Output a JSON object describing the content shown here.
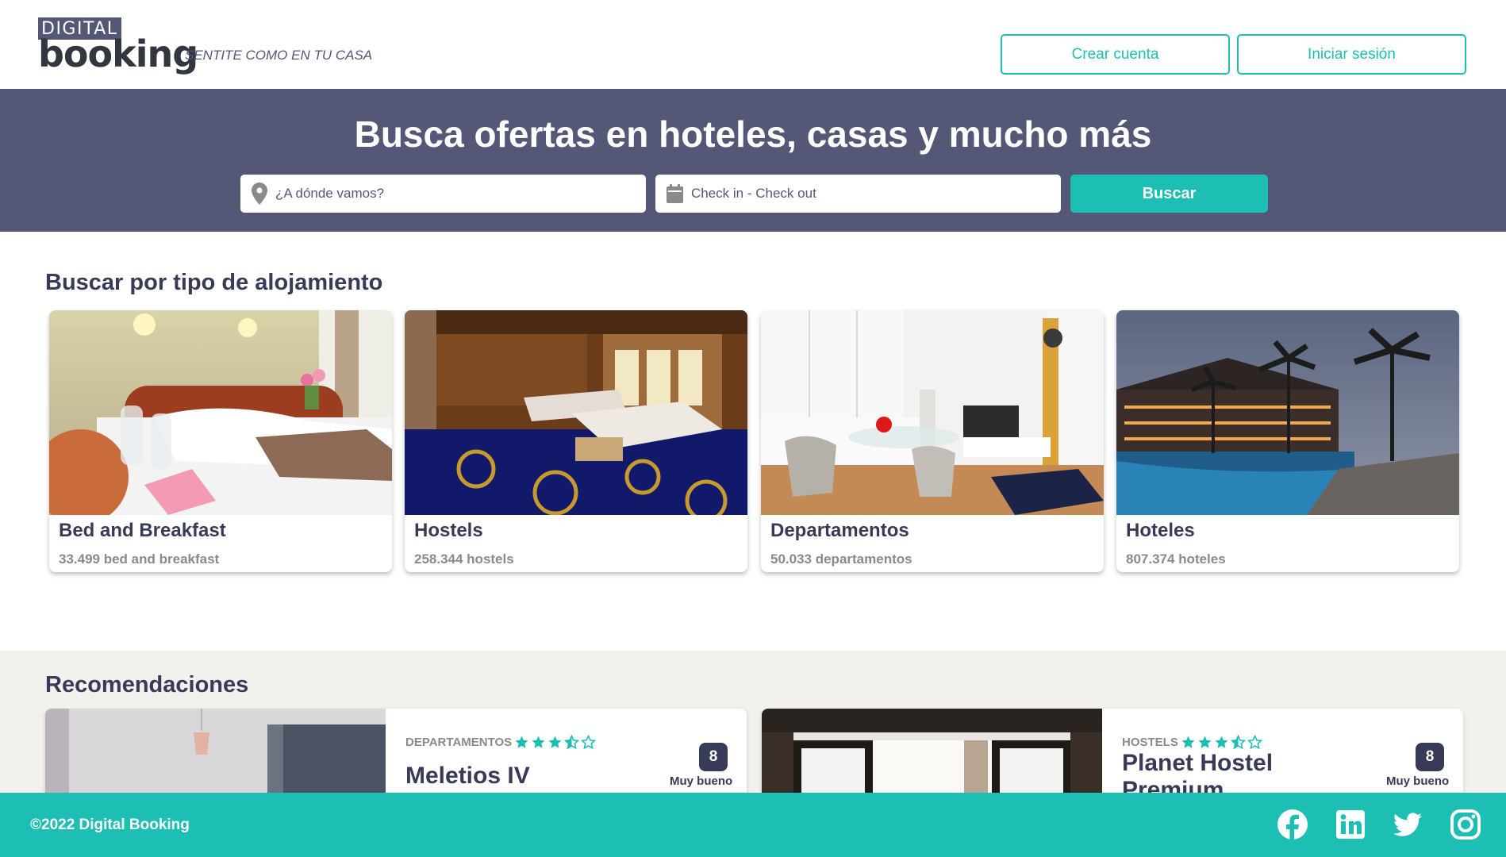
{
  "header": {
    "logo_top": "DIGITAL",
    "logo_bottom": "booking",
    "slogan": "SENTITE COMO EN TU CASA",
    "create_account": "Crear cuenta",
    "login": "Iniciar sesión"
  },
  "hero": {
    "title": "Busca ofertas en hoteles, casas y mucho más",
    "destination_placeholder": "¿A dónde vamos?",
    "dates_label": "Check in - Check out",
    "search_button": "Buscar"
  },
  "categories": {
    "title": "Buscar por tipo de alojamiento",
    "items": [
      {
        "title": "Bed and Breakfast",
        "count": "33.499 bed and breakfast"
      },
      {
        "title": "Hostels",
        "count": "258.344 hostels"
      },
      {
        "title": "Departamentos",
        "count": "50.033 departamentos"
      },
      {
        "title": "Hoteles",
        "count": "807.374 hoteles"
      }
    ]
  },
  "recommendations": {
    "title": "Recomendaciones",
    "items": [
      {
        "category": "DEPARTAMENTOS",
        "stars": 3.5,
        "name": "Meletios IV",
        "score": "8",
        "score_label": "Muy bueno"
      },
      {
        "category": "HOSTELS",
        "stars": 3.5,
        "name": "Planet Hostel Premium",
        "score": "8",
        "score_label": "Muy bueno"
      }
    ]
  },
  "footer": {
    "copyright": "©2022 Digital Booking"
  },
  "colors": {
    "primary": "#1dbeb4",
    "secondary": "#545776",
    "dark": "#383b58"
  }
}
